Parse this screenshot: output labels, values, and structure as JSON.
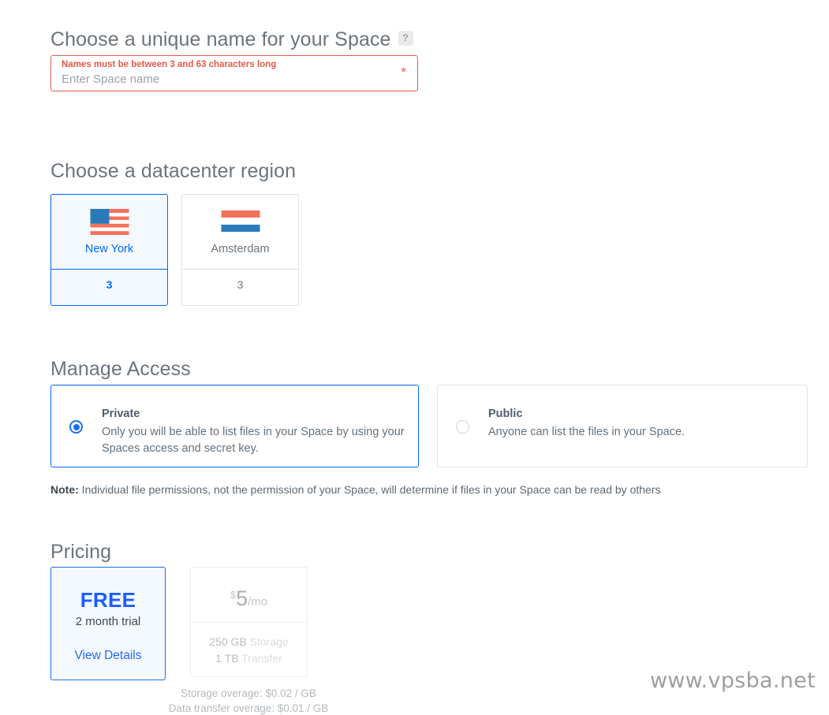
{
  "space_name": {
    "heading": "Choose a unique name for your Space",
    "help_icon_label": "?",
    "error_message": "Names must be between 3 and 63 characters long",
    "input_value": "",
    "placeholder": "Enter Space name",
    "required_marker": "*"
  },
  "region": {
    "heading": "Choose a datacenter region",
    "cards": [
      {
        "name": "New York",
        "count": "3",
        "flag": "us-flag-icon",
        "selected": true
      },
      {
        "name": "Amsterdam",
        "count": "3",
        "flag": "netherlands-flag-icon",
        "selected": false
      }
    ]
  },
  "access": {
    "heading": "Manage Access",
    "options": [
      {
        "title": "Private",
        "description": "Only you will be able to list files in your Space by using your Spaces access and secret key.",
        "selected": true
      },
      {
        "title": "Public",
        "description": "Anyone can list the files in your Space.",
        "selected": false
      }
    ],
    "note_label": "Note:",
    "note_text": " Individual file permissions, not the permission of your Space, will determine if files in your Space can be read by others"
  },
  "pricing": {
    "heading": "Pricing",
    "free_plan": {
      "title": "FREE",
      "subtitle": "2 month trial",
      "link": "View Details",
      "selected": true
    },
    "paid_plan": {
      "currency": "$",
      "amount": "5",
      "period": "/mo",
      "specs": [
        {
          "value": "250 GB",
          "word": " Storage"
        },
        {
          "value": "1 TB",
          "word": " Transfer"
        }
      ]
    },
    "overages": [
      "Storage overage: $0.02 / GB",
      "Data transfer overage: $0.01 / GB"
    ]
  },
  "watermark": "www.vpsba.net",
  "colors": {
    "accent_blue": "#0069ff",
    "error_red": "#e8584a",
    "flag_red": "#f4705b",
    "flag_blue": "#2a7ab9",
    "text_grey": "#6c747c"
  }
}
